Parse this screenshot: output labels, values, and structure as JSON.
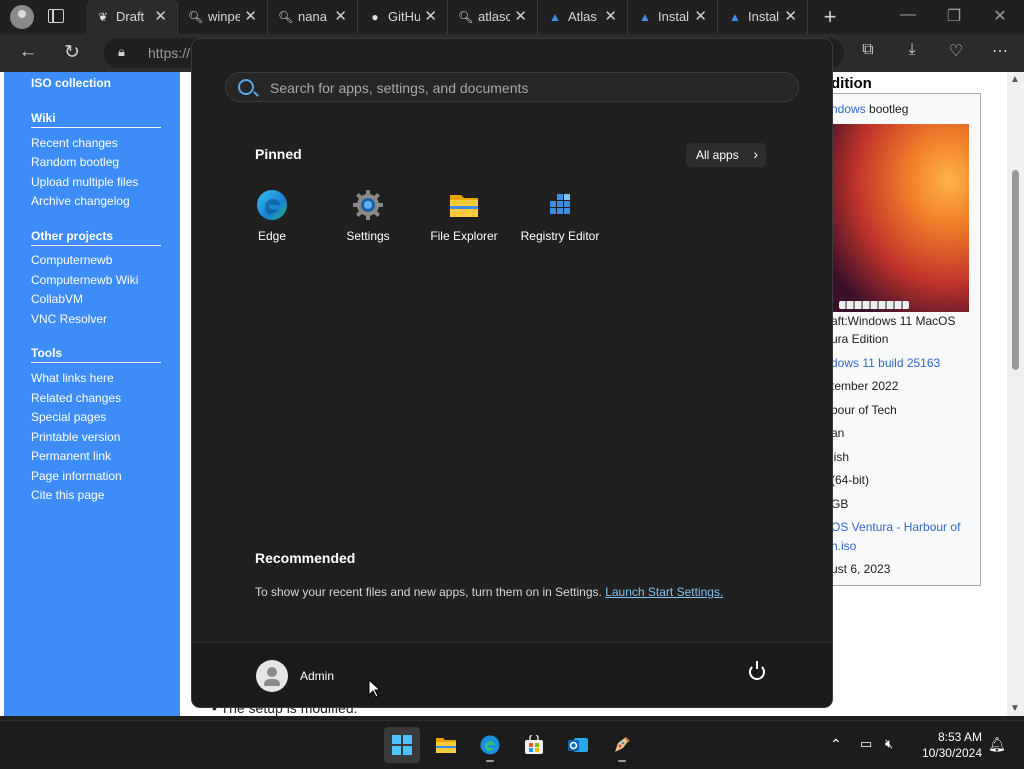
{
  "browser": {
    "tabs": [
      {
        "label": "Draft",
        "icon": "page-icon"
      },
      {
        "label": "winpe",
        "icon": "search-icon"
      },
      {
        "label": "nana",
        "icon": "search-icon"
      },
      {
        "label": "GitHu",
        "icon": "github-icon"
      },
      {
        "label": "atlasc",
        "icon": "search-icon"
      },
      {
        "label": "Atlas",
        "icon": "atlas-icon"
      },
      {
        "label": "Instal",
        "icon": "atlas-icon"
      },
      {
        "label": "Instal",
        "icon": "atlas-icon"
      }
    ],
    "url": "https://"
  },
  "page": {
    "nav": {
      "top_link": "ISO collection",
      "sections": [
        {
          "heading": "Wiki",
          "links": [
            "Recent changes",
            "Random bootleg",
            "Upload multiple files",
            "Archive changelog"
          ]
        },
        {
          "heading": "Other projects",
          "links": [
            "Computernewb",
            "Computernewb Wiki",
            "CollabVM",
            "VNC Resolver"
          ]
        },
        {
          "heading": "Tools",
          "links": [
            "What links here",
            "Related changes",
            "Special pages",
            "Printable version",
            "Permanent link",
            "Page information",
            "Cite this page"
          ]
        }
      ]
    },
    "infobox": {
      "title": "dition",
      "type_prefix": "ndows",
      "type_suffix": " bootleg",
      "caption_line1": "aft:Windows 11 MacOS",
      "caption_line2": "ura Edition",
      "based_on": "dows 11 build 25163",
      "date": "tember 2022",
      "author": "bour of Tech",
      "lang1": "an",
      "lang2": "lish",
      "arch": "(64-bit)",
      "size": "GB",
      "file_line1": "OS Ventura - Harbour of",
      "file_line2": "h.iso",
      "release": "ust 6, 2023"
    },
    "bottom_text": "The setup is modified."
  },
  "start_menu": {
    "search_placeholder": "Search for apps, settings, and documents",
    "pinned_title": "Pinned",
    "all_apps_label": "All apps",
    "pinned_apps": [
      {
        "label": "Edge",
        "icon": "edge-icon"
      },
      {
        "label": "Settings",
        "icon": "gear-icon"
      },
      {
        "label": "File Explorer",
        "icon": "folder-icon"
      },
      {
        "label": "Registry Editor",
        "icon": "registry-icon"
      }
    ],
    "recommended_title": "Recommended",
    "recommended_text": "To show your recent files and new apps, turn them on in Settings.",
    "recommended_link": "Launch Start Settings.",
    "user_name": "Admin"
  },
  "taskbar": {
    "apps": [
      "start-icon",
      "file-explorer-icon",
      "edge-icon",
      "store-icon",
      "outlook-icon",
      "paint-icon"
    ],
    "time": "8:53 AM",
    "date": "10/30/2024"
  },
  "colors": {
    "accent_blue": "#3d8cf7",
    "start_bg": "#202020",
    "link": "#7fc4f3"
  }
}
